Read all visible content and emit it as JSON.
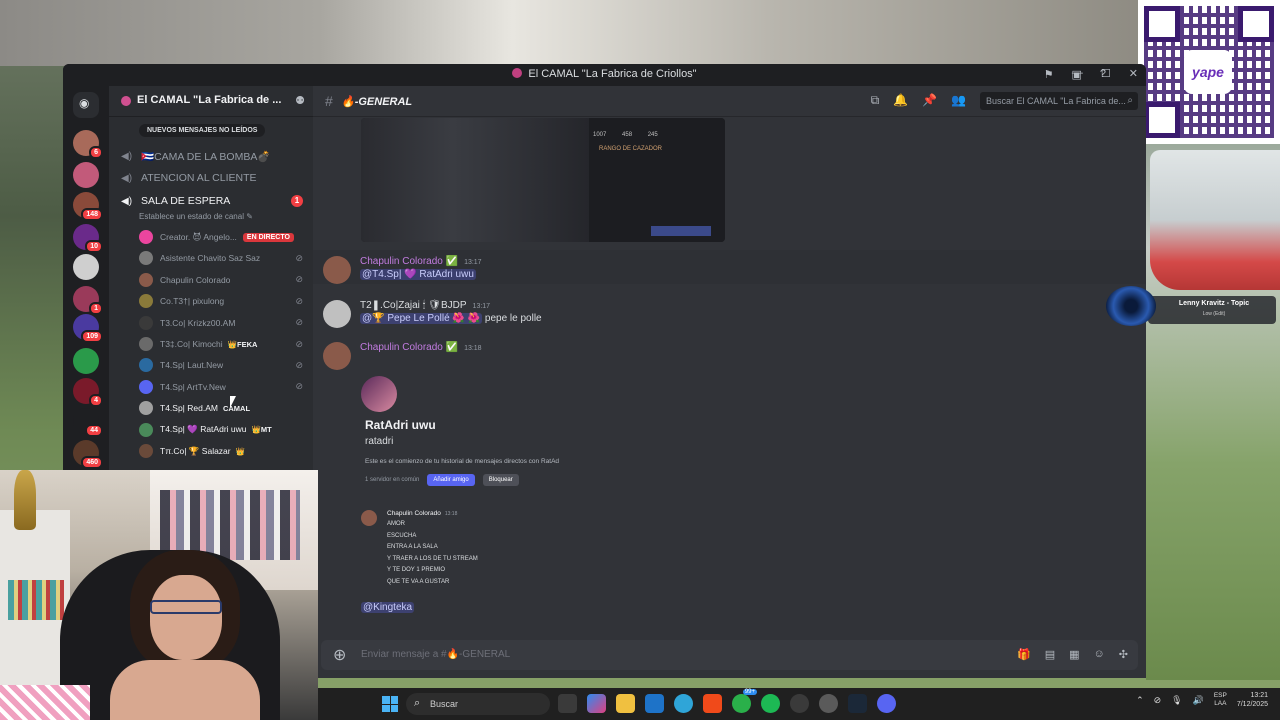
{
  "window": {
    "title": "El CAMAL \"La Fabrica de Criollos\"",
    "controls": [
      "—",
      "☐",
      "✕"
    ]
  },
  "guilds": [
    {
      "badge": "6",
      "color": "#a86a5a"
    },
    {
      "badge": "",
      "color": "#c25a7a"
    },
    {
      "badge": "148",
      "color": "#8a4a3a"
    },
    {
      "badge": "10",
      "color": "#6a2a8a"
    },
    {
      "badge": "",
      "color": "#cfcfcf"
    },
    {
      "badge": "1",
      "color": "#9a3a5a"
    },
    {
      "badge": "109",
      "color": "#4a3aa0"
    },
    {
      "badge": "",
      "color": "#2a9a4a"
    },
    {
      "badge": "4",
      "color": "#7a1a2a"
    },
    {
      "badge": "44",
      "color": "#1e1f22"
    },
    {
      "badge": "460",
      "color": "#5a3a2a"
    }
  ],
  "server": {
    "name": "El CAMAL \"La Fabrica de ...",
    "unread_label": "NUEVOS MENSAJES NO LEÍDOS",
    "channels": [
      {
        "name": "🇨🇺CAMA DE LA BOMBA💣",
        "icon": "speaker-icon"
      },
      {
        "name": "ATENCION AL CLIENTE",
        "icon": "speaker-icon"
      },
      {
        "name": "SALA DE ESPERA",
        "icon": "speaker-icon",
        "badge": "1"
      }
    ],
    "channel_status": "Establece un estado de canal ✎",
    "voice_users": [
      {
        "name": "Creator. 😈 Angelo...",
        "tag": "EN DIRECTO",
        "color": "#eb459e"
      },
      {
        "name": "Asistente Chavito Saz Saz",
        "tag": "",
        "color": "#7a7a7a"
      },
      {
        "name": "Chapulin Colorado",
        "tag": "",
        "color": "#8a5a4a"
      },
      {
        "name": "Co.T3†| pixulong",
        "tag": "",
        "color": "#8a7a3a"
      },
      {
        "name": "T3.Co| Krizkz00.AM",
        "tag": "",
        "color": "#3a3a3a"
      },
      {
        "name": "T3‡.Co| Kimochi",
        "tag": "👑FEKA",
        "color": "#6a6a6a"
      },
      {
        "name": "T4.Sp| Laut.New",
        "tag": "",
        "color": "#2a6aa0"
      },
      {
        "name": "T4.Sp| ArtTv.New",
        "tag": "",
        "color": "#5865f2"
      },
      {
        "name": "T4.Sp| Red.AM",
        "tag": "CAMAL",
        "color": "#a0a0a0"
      },
      {
        "name": "T4.Sp| 💜 RatAdri uwu",
        "tag": "👑MT",
        "color": "#4a8a5a"
      },
      {
        "name": "Tπ.Co| 🏆 Salazar",
        "tag": "👑",
        "color": "#6a4a3a"
      }
    ]
  },
  "chat": {
    "channel_name": "🔥-GENERAL",
    "search_placeholder": "Buscar El CAMAL \"La Fabrica de...",
    "screenshot": {
      "nums": "1007 458 245",
      "rango": "RANGO DE CAZADOR"
    },
    "messages": [
      {
        "author": "Chapulin Colorado ✅",
        "time": "13:17",
        "mention": "@T4.Sp| 💜 RatAdri uwu",
        "text": ""
      },
      {
        "author": "T2❚.Co|Zajai 🕯 🛡BJDP",
        "time": "13:17",
        "mention": "@🏆 Pepe Le Pollé 🌺 🌺",
        "text": " pepe le polle"
      },
      {
        "author": "Chapulin Colorado ✅",
        "time": "13:18",
        "mention": "",
        "text": ""
      }
    ],
    "card": {
      "display_name": "RatAdri uwu",
      "username": "ratadri",
      "description": "Este es el comienzo de tu historial de mensajes directos con RatAd",
      "mutual": "1 servidor en común",
      "add_label": "Añadir amigo",
      "block_label": "Bloquear"
    },
    "inner_message": {
      "author": "Chapulin Colorado",
      "time": "13:18",
      "lines": [
        "AMOR",
        "ESCUCHA",
        "ENTRA A LA SALA",
        "Y TRAER A LOS DE TU STREAM",
        "Y TE DOY 1 PREMIO",
        "QUE TE VA A GUSTAR"
      ]
    },
    "last_mention": "@Kingteka",
    "composer_placeholder": "Enviar mensaje a #🔥-GENERAL"
  },
  "overlay": {
    "music_title": "Lenny Kravitz - Topic",
    "music_sub": "Low (Edit)",
    "qr_logo": "yape"
  },
  "taskbar": {
    "search_label": "Buscar",
    "badge": "99+",
    "lang_top": "ESP",
    "lang_bottom": "LAA",
    "time": "13:21",
    "date": "7/12/2025"
  }
}
